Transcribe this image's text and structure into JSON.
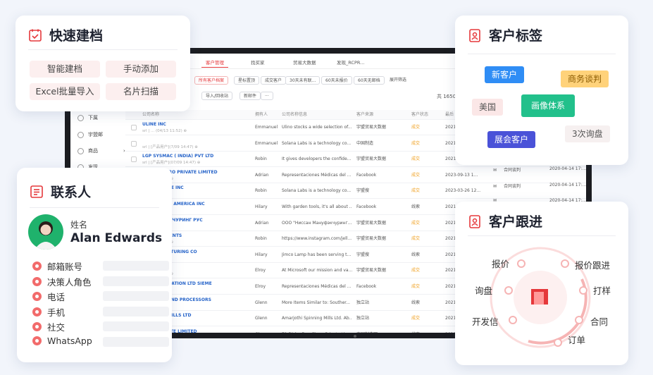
{
  "quick_create": {
    "title": "快速建档",
    "buttons": [
      "智能建档",
      "手动添加",
      "Excel批量导入",
      "名片扫描"
    ]
  },
  "tags": {
    "title": "客户标签",
    "items": [
      {
        "label": "新客户",
        "bg": "#2f8df5",
        "fg": "#ffffff"
      },
      {
        "label": "商务谈判",
        "bg": "#ffd27a",
        "fg": "#8a5a00"
      },
      {
        "label": "美国",
        "bg": "#fbe7e7",
        "fg": "#555555"
      },
      {
        "label": "画像体系",
        "bg": "#22c08b",
        "fg": "#ffffff"
      },
      {
        "label": "展会客户",
        "bg": "#4a52d8",
        "fg": "#ffffff"
      },
      {
        "label": "3次询盘",
        "bg": "#f6f0f0",
        "fg": "#555555"
      }
    ]
  },
  "contact": {
    "title": "联系人",
    "name_label": "姓名",
    "name": "Alan Edwards",
    "fields": [
      "邮箱账号",
      "决策人角色",
      "电话",
      "手机",
      "社交",
      "WhatsApp"
    ]
  },
  "follow": {
    "title": "客户跟进",
    "steps": [
      "报价",
      "报价跟进",
      "询盘",
      "打样",
      "开发信",
      "合同",
      "订单"
    ]
  },
  "app": {
    "tabs": [
      "客户管理",
      "找买家",
      "贸易大数据",
      "发现_RCPR..."
    ],
    "filters": [
      "所有客户档案",
      "星标置顶",
      "成交客户",
      "30天未有联...",
      "60天未报价",
      "60天无邮档",
      "展开筛选"
    ],
    "toolbar": [
      "导入/回收站",
      "新邮件",
      "···"
    ],
    "count": "共 1650 条",
    "sidebar": [
      "下属",
      "宇盟邮",
      "商品",
      "发现"
    ],
    "headers": [
      "公司名称",
      "拥有人",
      "公司名称信息",
      "客户来源",
      "客户状态",
      "最后"
    ],
    "rows": [
      {
        "name": "ULINE INC",
        "sub": "srl | ... (04/13 11:52) ⊕",
        "owner": "Emmanuel",
        "info": "Ulino stocks a wide selection of...",
        "source": "宇盟贸易大数据",
        "status": "成交",
        "date": "2021"
      },
      {
        "name": "",
        "sub": "srl | [产品用户](7/09 14:47) ⊕",
        "owner": "Emmanuel",
        "info": "Solana Labs is a technology co...",
        "source": "中国制造",
        "status": "成交",
        "date": "2021"
      },
      {
        "name": "LGP SYSMAC ( INDIA) PVT LTD",
        "sub": "srl | [产品用户](07/09 14:47) ⊕",
        "owner": "Robin",
        "info": "It gives developers the confide...",
        "source": "宇盟贸易大数据",
        "status": "成交",
        "date": "2021"
      },
      {
        "name": "IFE BUILDPRO PRIVATE LIMITED",
        "sub": "(09/13 17:17) ⊕",
        "owner": "Adrian",
        "info": "Representaciones Médicas del ...",
        "source": "Facebook",
        "status": "成交",
        "date": "2023-09-13 1..."
      },
      {
        "name": "ES @SERVICE INC",
        "sub": "",
        "owner": "Robin",
        "info": "Solana Labs is a technology co...",
        "source": "宇盟搜",
        "status": "成交",
        "date": "2023-03-26 12..."
      },
      {
        "name": "SIGN NORTH AMERICA INC",
        "sub": "",
        "owner": "Hilary",
        "info": "With garden tools, it's all about ...",
        "source": "Facebook",
        "status": "线索",
        "date": "2021"
      },
      {
        "name": "Н МЭНУФЭКЧУРИНГ РУС",
        "sub": "(3/21 22:16) ⊕",
        "owner": "Adrian",
        "info": "ООО \"Ниссан Мануфэкчуринг...",
        "source": "宇盟贸易大数据",
        "status": "成交",
        "date": "2021"
      },
      {
        "name": "LAMPS ACCENTS",
        "sub": "(06/08 19:43) ⊕",
        "owner": "Robin",
        "info": "https://www.instagram.com/jell...",
        "source": "宇盟贸易大数据",
        "status": "成交",
        "date": "2021"
      },
      {
        "name": "& MANUFACTURING CO",
        "sub": "",
        "owner": "Hilary",
        "info": "Jimco Lamp has been serving t...",
        "source": "宇盟搜",
        "status": "线索",
        "date": "2021"
      },
      {
        "name": "CORP",
        "sub": "(09/18 14:51) ⊕",
        "owner": "Elroy",
        "info": "At Microsoft our mission and va...",
        "source": "宇盟贸易大数据",
        "status": "成交",
        "date": "2021"
      },
      {
        "name": "MER AUTOMATION LTD SIEME",
        "sub": "",
        "owner": "Elroy",
        "info": "Representaciones Médicas del ...",
        "source": "Facebook",
        "status": "成交",
        "date": "2021"
      },
      {
        "name": "SPINNERS AND PROCESSORS",
        "sub": "(09 12:22) ⊕",
        "owner": "Glenn",
        "info": "More Items Similar to: Souther...",
        "source": "独立站",
        "status": "线索",
        "date": "2021"
      },
      {
        "name": "SPINNING MILLS LTD",
        "sub": "(09 12:22) ⊕",
        "owner": "Glenn",
        "info": "Amarjothi Spinning Mills Ltd. Ab...",
        "source": "独立站",
        "status": "成交",
        "date": "2021"
      },
      {
        "name": "NERS PRIVATE LIMITED",
        "sub": "(04/15 12:28) ⊕",
        "owner": "Glenn",
        "info": "71 Disha Dye Chem Private Lim...",
        "source": "中国制造网",
        "status": "线索",
        "date": "2021"
      }
    ],
    "extra": [
      {
        "type": "合同谈判",
        "date": "2020-04-14 17:..."
      },
      {
        "type": "合同谈判",
        "date": "2020-04-14 17:..."
      },
      {
        "type": "",
        "date": "2020-04-14 17:..."
      }
    ]
  }
}
